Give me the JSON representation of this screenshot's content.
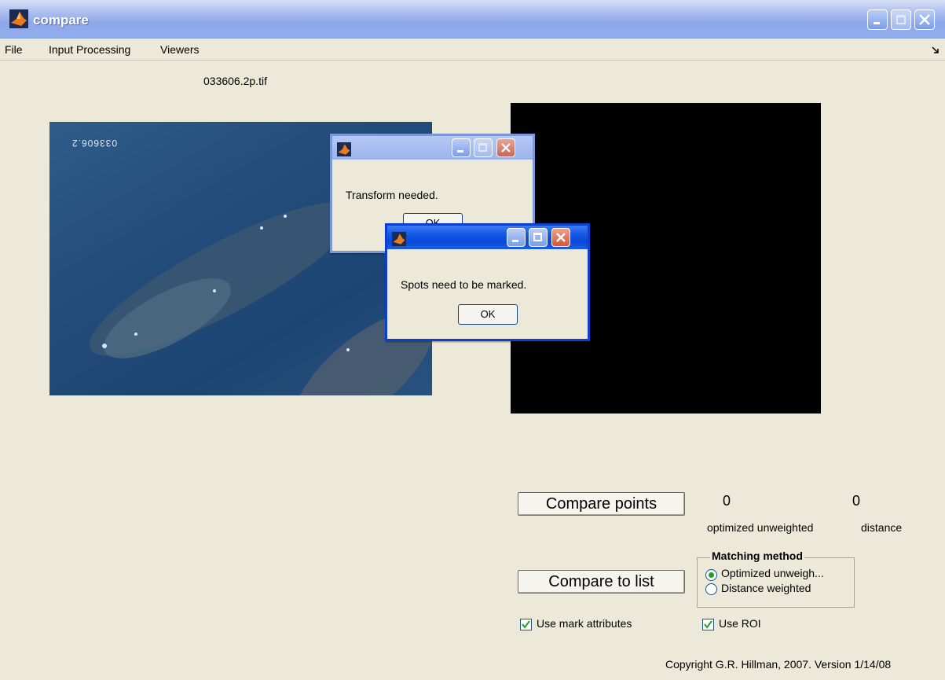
{
  "window": {
    "title": "compare"
  },
  "menu": {
    "items": [
      "File",
      "Input Processing",
      "Viewers"
    ]
  },
  "image": {
    "filename": "033606.2p.tif",
    "photo_label": "033606.2"
  },
  "dialogs": [
    {
      "message": "Transform needed.",
      "ok_label": "OK",
      "active": false
    },
    {
      "message": "Spots need to be marked.",
      "ok_label": "OK",
      "active": true
    }
  ],
  "buttons": {
    "compare_points": "Compare points",
    "compare_to_list": "Compare to list"
  },
  "results": {
    "optimized_value": "0",
    "distance_value": "0",
    "optimized_label": "optimized unweighted",
    "distance_label": "distance"
  },
  "matching": {
    "title": "Matching method",
    "options": [
      "Optimized unweigh...",
      "Distance weighted"
    ],
    "selected": 0
  },
  "checkboxes": {
    "use_mark_attributes": "Use mark attributes",
    "use_roi": "Use ROI"
  },
  "footer": {
    "copyright": "Copyright G.R. Hillman, 2007. Version 1/14/08"
  },
  "colors": {
    "titlebar": "#8ea8ea",
    "active_dialog": "#0a48d6",
    "close_red": "#d2563a",
    "background": "#ece9d8"
  }
}
